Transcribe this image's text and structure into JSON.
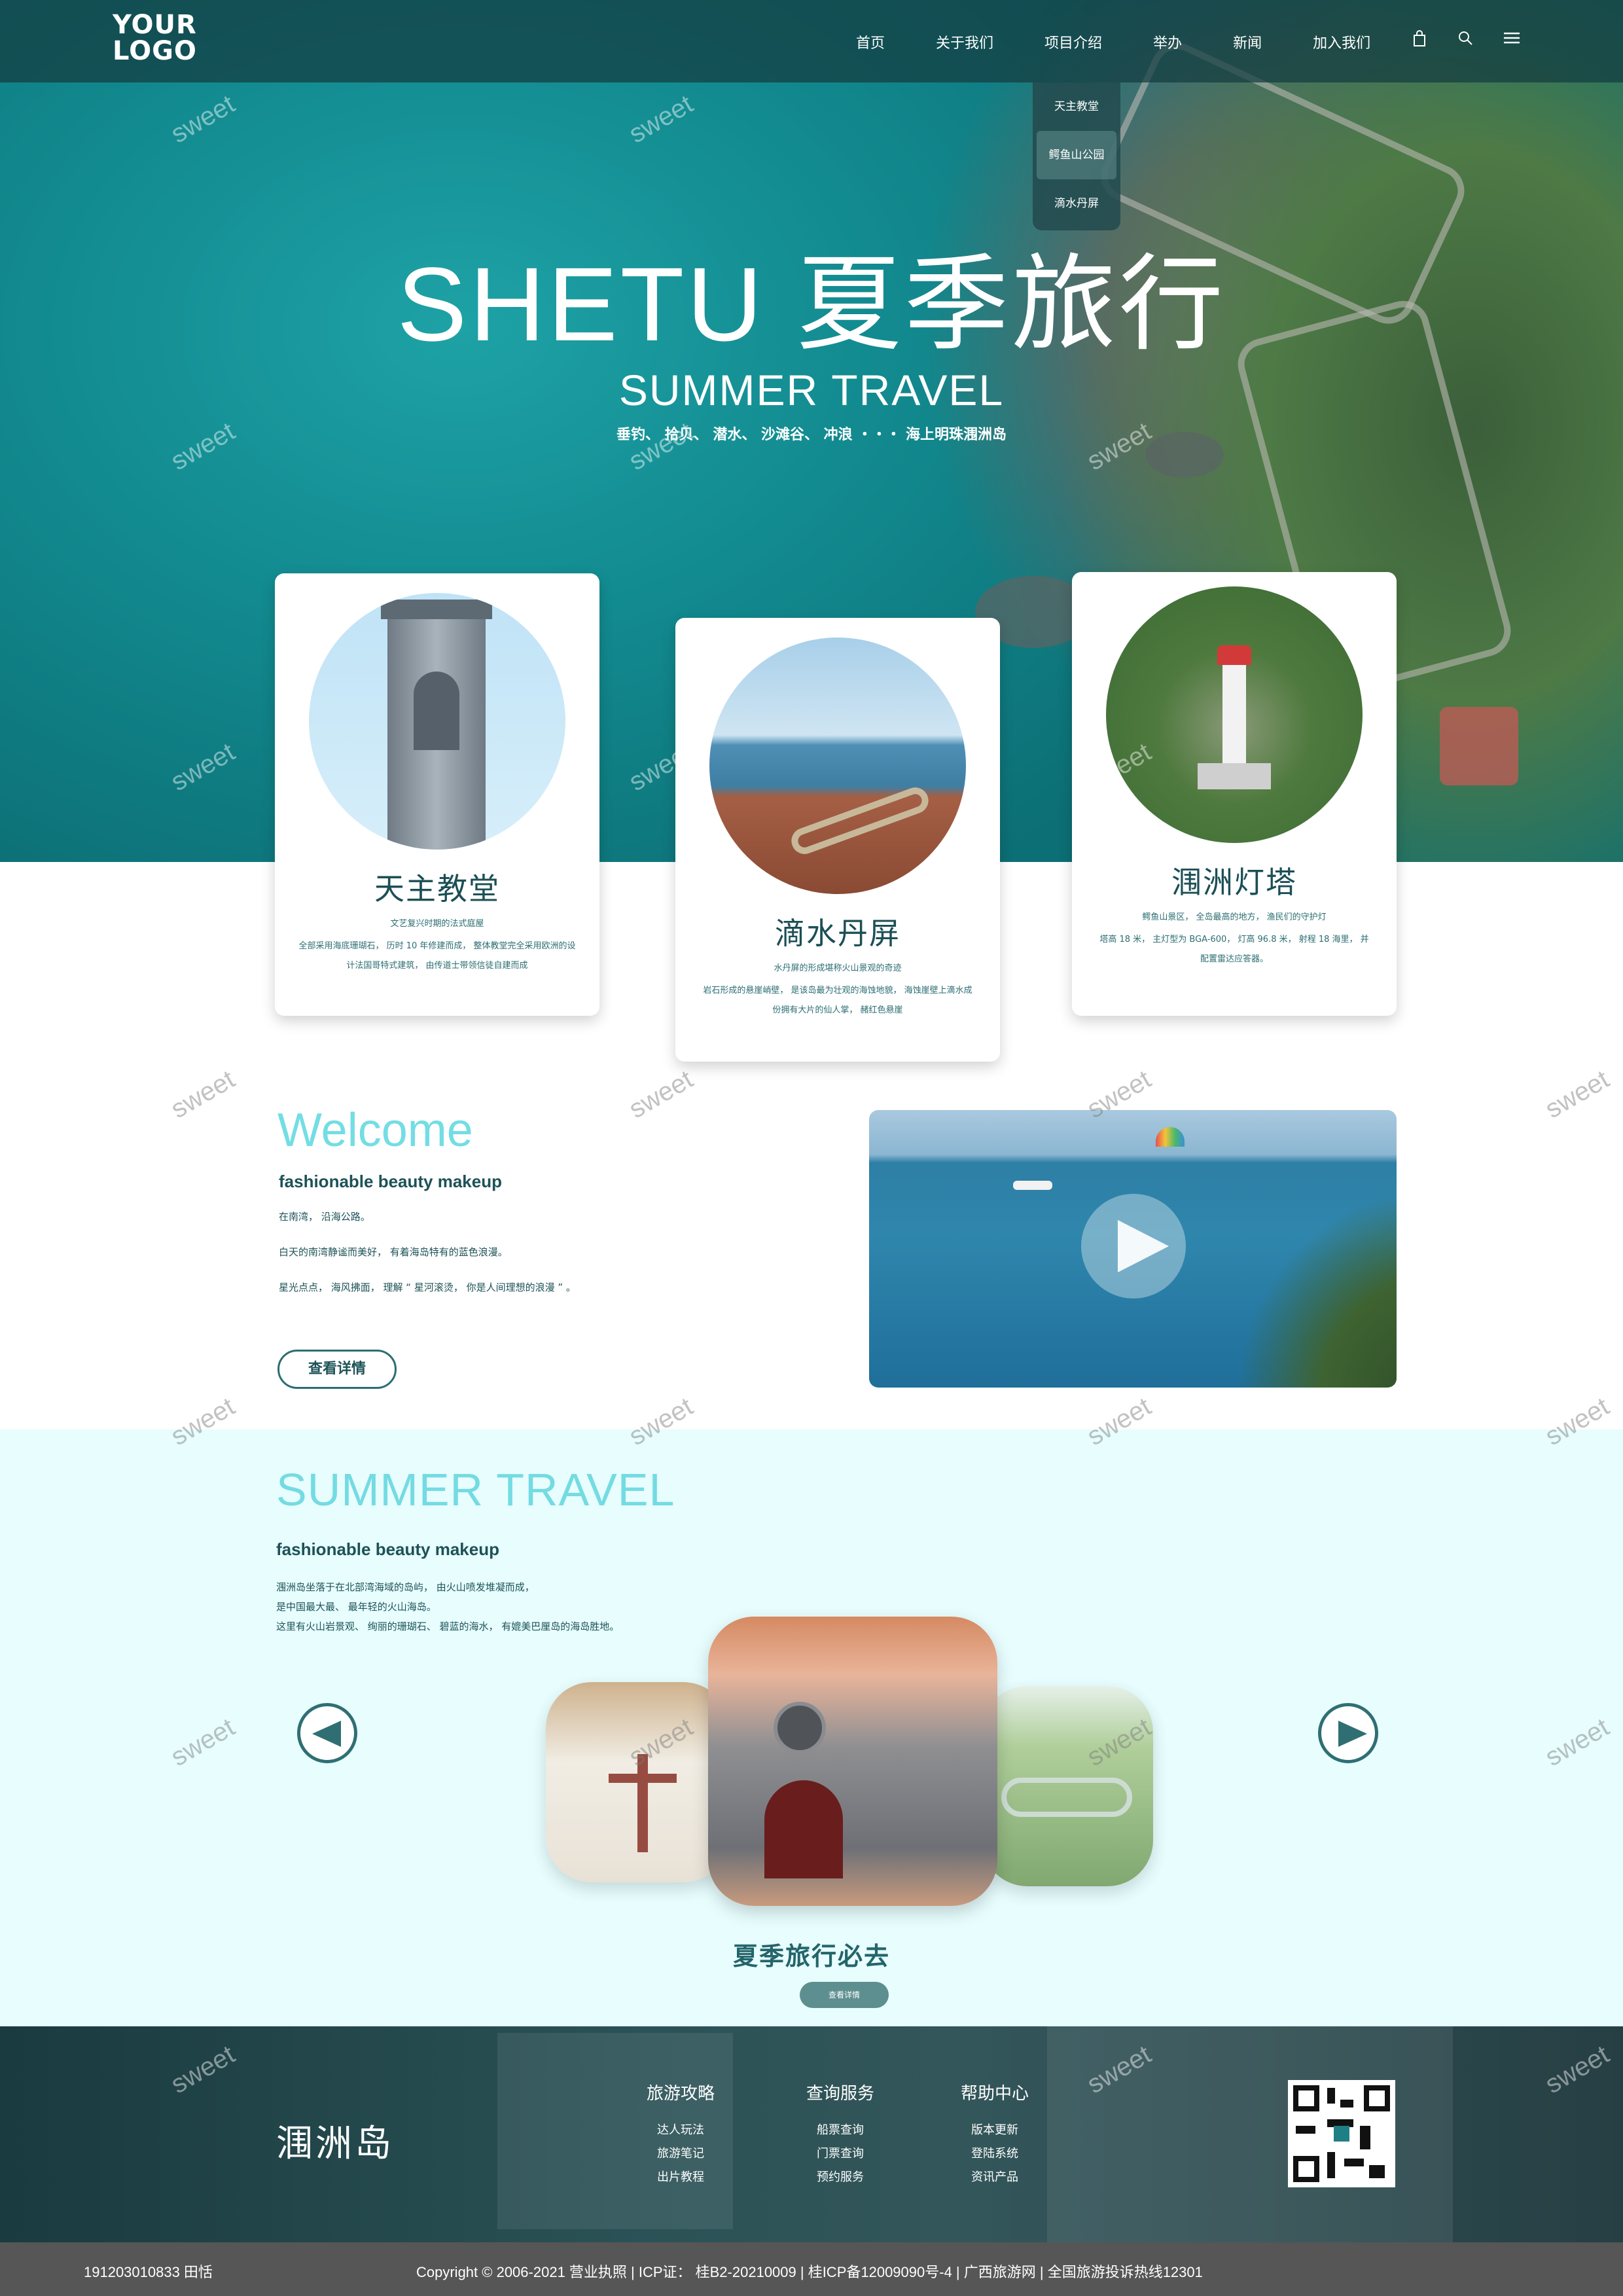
{
  "header": {
    "logo_line1": "YOUR",
    "logo_line2": "LOGO",
    "nav": [
      "首页",
      "关于我们",
      "项目介绍",
      "举办",
      "新闻",
      "加入我们"
    ],
    "icons": [
      "bag-icon",
      "search-icon",
      "menu-icon"
    ],
    "dropdown": [
      "天主教堂",
      "鳄鱼山公园",
      "滴水丹屏"
    ]
  },
  "hero": {
    "title": "SHETU 夏季旅行",
    "subtitle": "SUMMER TRAVEL",
    "tagline": "垂钓、 拾贝、 潜水、 沙滩谷、 冲浪 ・・・ 海上明珠涠洲岛"
  },
  "cards": [
    {
      "title": "天主教堂",
      "subtitle": "文艺复兴时期的法式庭屋",
      "desc": "全部采用海底珊瑚石， 历时 10 年修建而成， 整体教堂完全采用欧洲的设计法国哥特式建筑， 由传道士带领信徒自建而成"
    },
    {
      "title": "滴水丹屏",
      "subtitle": "水丹屏的形成堪称火山景观的奇迹",
      "desc": "岩石形成的悬崖峭壁， 是该岛最为壮观的海蚀地貌， 海蚀崖壁上滴水成份拥有大片的仙人掌， 赭红色悬崖"
    },
    {
      "title": "涠洲灯塔",
      "subtitle": "鳄鱼山景区， 全岛最高的地方， 渔民们的守护灯",
      "desc": "塔高 18 米， 主灯型为 BGA-600， 灯高 96.8 米， 射程 18 海里， 并配置雷达应答器。"
    }
  ],
  "welcome": {
    "title": "Welcome",
    "subtitle": "fashionable beauty makeup",
    "lines": [
      "在南湾， 沿海公路。",
      "白天的南湾静谧而美好， 有着海岛特有的蓝色浪漫。",
      "星光点点， 海风拂面， 理解 “ 星河滚烫， 你是人间理想的浪漫 ” 。"
    ],
    "button": "查看详情"
  },
  "summer": {
    "title": "SUMMER TRAVEL",
    "subtitle": "fashionable beauty makeup",
    "lines": [
      "涠洲岛坐落于在北部湾海域的岛屿， 由火山喷发堆凝而成，",
      "是中国最大最、 最年轻的火山海岛。",
      "这里有火山岩景观、 绚丽的珊瑚石、 碧蓝的海水， 有媲美巴厘岛的海岛胜地。"
    ],
    "caption": "夏季旅行必去",
    "button": "查看详情"
  },
  "footer": {
    "brand": "涠洲岛",
    "columns": [
      {
        "title": "旅游攻略",
        "links": [
          "达人玩法",
          "旅游笔记",
          "出片教程"
        ]
      },
      {
        "title": "查询服务",
        "links": [
          "船票查询",
          "门票查询",
          "预约服务"
        ]
      },
      {
        "title": "帮助中心",
        "links": [
          "版本更新",
          "登陆系统",
          "资讯产品"
        ]
      }
    ],
    "copy_left": "191203010833   田恬",
    "copyright": "Copyright © 2006-2021 营业执照 | ICP证： 桂B2-20210009 | 桂ICP备12009090号-4 | 广西旅游网 | 全国旅游投诉热线12301"
  },
  "watermark": "sweet",
  "colors": {
    "accent_cyan": "#74dbe2",
    "dark_teal": "#1d5257",
    "summer_bg": "#e7fdfe",
    "copy_bar": "#565656"
  }
}
